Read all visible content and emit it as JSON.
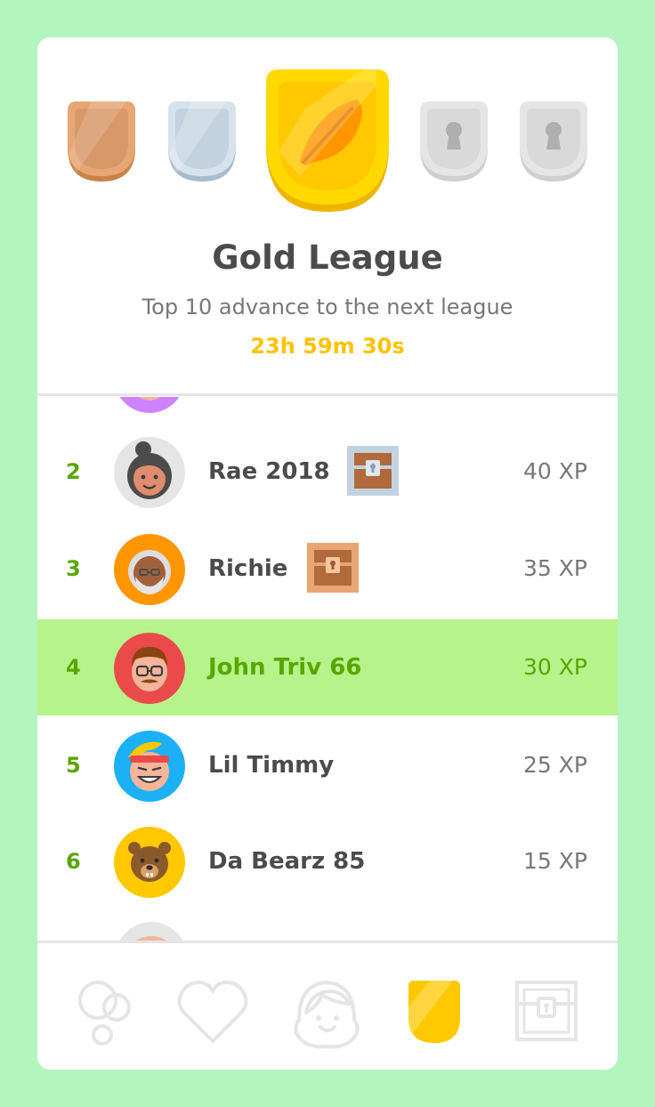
{
  "league": {
    "title": "Gold League",
    "subtitle": "Top 10 advance to the next league",
    "timer": "23h 59m 30s",
    "badges": [
      "bronze",
      "silver",
      "gold",
      "locked",
      "locked"
    ],
    "colors": {
      "gold": "#ffc800",
      "accent_green": "#58a700",
      "highlight": "#b6f38a"
    }
  },
  "leaderboard": [
    {
      "rank": "2",
      "name": "Rae 2018",
      "xp": "40 XP",
      "chest": "silver-chest"
    },
    {
      "rank": "3",
      "name": "Richie",
      "xp": "35 XP",
      "chest": "bronze-chest"
    },
    {
      "rank": "4",
      "name": "John Triv 66",
      "xp": "30 XP",
      "current_user": true
    },
    {
      "rank": "5",
      "name": "Lil Timmy",
      "xp": "25 XP"
    },
    {
      "rank": "6",
      "name": "Da Bearz 85",
      "xp": "15 XP"
    }
  ],
  "nav": [
    {
      "icon": "learn-bubbles-icon"
    },
    {
      "icon": "heart-icon"
    },
    {
      "icon": "profile-icon"
    },
    {
      "icon": "league-shield-icon",
      "active": true
    },
    {
      "icon": "shop-chest-icon"
    }
  ]
}
